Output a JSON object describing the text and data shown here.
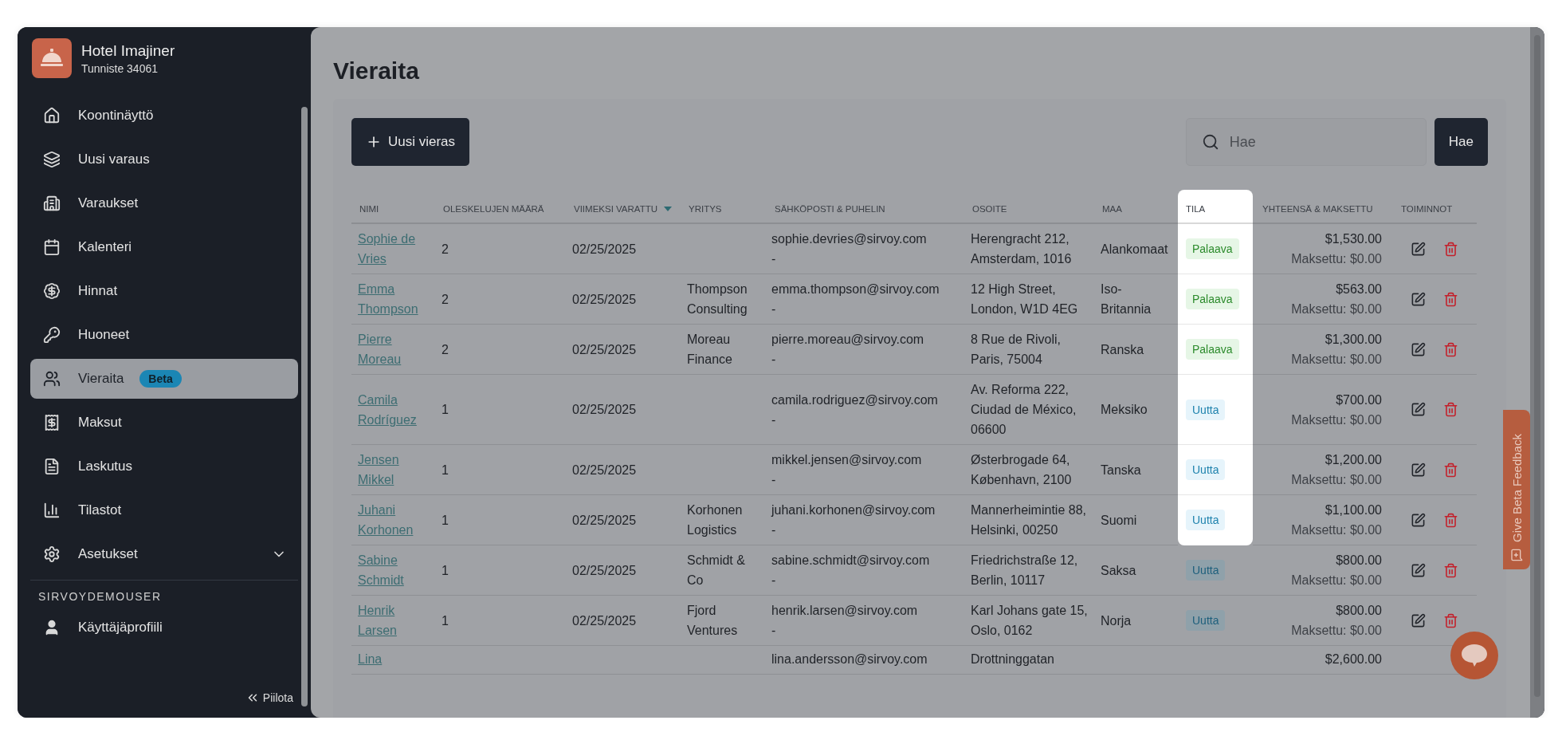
{
  "sidebar": {
    "hotel_name": "Hotel Imajiner",
    "hotel_id": "Tunniste 34061",
    "items": [
      {
        "label": "Koontinäyttö",
        "selected": false
      },
      {
        "label": "Uusi varaus",
        "selected": false
      },
      {
        "label": "Varaukset",
        "selected": false
      },
      {
        "label": "Kalenteri",
        "selected": false
      },
      {
        "label": "Hinnat",
        "selected": false
      },
      {
        "label": "Huoneet",
        "selected": false
      },
      {
        "label": "Vieraita",
        "selected": true,
        "badge": "Beta"
      },
      {
        "label": "Maksut",
        "selected": false
      },
      {
        "label": "Laskutus",
        "selected": false
      },
      {
        "label": "Tilastot",
        "selected": false
      },
      {
        "label": "Asetukset",
        "selected": false,
        "expanded": false
      }
    ],
    "user_section": "SIRVOYDEMOUSER",
    "user_items": [
      {
        "label": "Käyttäjäprofiili",
        "selected": false
      }
    ],
    "collapse": "Piilota"
  },
  "page_title": "Vieraita",
  "new_button": "Uusi vieras",
  "search": {
    "placeholder": "Hae",
    "button": "Hae"
  },
  "table": {
    "columns": [
      {
        "label": "NIMI",
        "sorted": false,
        "highlighted": false
      },
      {
        "label": "OLESKELUJEN MÄÄRÄ",
        "sorted": false,
        "highlighted": false
      },
      {
        "label": "VIIMEKSI VARATTU",
        "sorted": true,
        "highlighted": false
      },
      {
        "label": "YRITYS",
        "sorted": false,
        "highlighted": false
      },
      {
        "label": "SÄHKÖPOSTI & PUHELIN",
        "sorted": false,
        "highlighted": false
      },
      {
        "label": "OSOITE",
        "sorted": false,
        "highlighted": false
      },
      {
        "label": "MAA",
        "sorted": false,
        "highlighted": false
      },
      {
        "label": "TILA",
        "sorted": false,
        "highlighted": true
      },
      {
        "label": "YHTEENSÄ & MAKSETTU",
        "sorted": false,
        "highlighted": false
      },
      {
        "label": "TOIMINNOT",
        "sorted": false,
        "highlighted": false
      }
    ],
    "rows": [
      {
        "name": "Sophie de Vries",
        "stays": "2",
        "last_booked": "02/25/2025",
        "email": "sophie.devries@sirvoy.com",
        "phone": "-",
        "address": "Herengracht 212, Amsterdam, 1016",
        "country": "Alankomaat",
        "status": {
          "label": "Palaava",
          "kind": "returning",
          "highlighted": true
        },
        "total": "$1,530.00",
        "paid": "Maksettu: $0.00",
        "partial": false
      },
      {
        "name": "Emma Thompson",
        "stays": "2",
        "last_booked": "02/25/2025",
        "company": "Thompson Consulting",
        "email": "emma.thompson@sirvoy.com",
        "phone": "-",
        "address": "12 High Street, London, W1D 4EG",
        "country": "Iso-Britannia",
        "status": {
          "label": "Palaava",
          "kind": "returning",
          "highlighted": true
        },
        "total": "$563.00",
        "paid": "Maksettu: $0.00",
        "partial": false
      },
      {
        "name": "Pierre Moreau",
        "stays": "2",
        "last_booked": "02/25/2025",
        "company": "Moreau Finance",
        "email": "pierre.moreau@sirvoy.com",
        "phone": "-",
        "address": "8 Rue de Rivoli, Paris, 75004",
        "country": "Ranska",
        "status": {
          "label": "Palaava",
          "kind": "returning",
          "highlighted": true
        },
        "total": "$1,300.00",
        "paid": "Maksettu: $0.00",
        "partial": false
      },
      {
        "name": "Camila Rodríguez",
        "stays": "1",
        "last_booked": "02/25/2025",
        "email": "camila.rodriguez@sirvoy.com",
        "phone": "-",
        "address": "Av. Reforma 222, Ciudad de México, 06600",
        "country": "Meksiko",
        "status": {
          "label": "Uutta",
          "kind": "new",
          "highlighted": true
        },
        "total": "$700.00",
        "paid": "Maksettu: $0.00",
        "partial": false
      },
      {
        "name": "Jensen Mikkel",
        "stays": "1",
        "last_booked": "02/25/2025",
        "email": "mikkel.jensen@sirvoy.com",
        "phone": "-",
        "address": "Østerbrogade 64, København, 2100",
        "country": "Tanska",
        "status": {
          "label": "Uutta",
          "kind": "new",
          "highlighted": true
        },
        "total": "$1,200.00",
        "paid": "Maksettu: $0.00",
        "partial": false
      },
      {
        "name": "Juhani Korhonen",
        "stays": "1",
        "last_booked": "02/25/2025",
        "company": "Korhonen Logistics",
        "email": "juhani.korhonen@sirvoy.com",
        "phone": "-",
        "address": "Mannerheimintie 88, Helsinki, 00250",
        "country": "Suomi",
        "status": {
          "label": "Uutta",
          "kind": "new",
          "highlighted": true
        },
        "total": "$1,100.00",
        "paid": "Maksettu: $0.00",
        "partial": false
      },
      {
        "name": "Sabine Schmidt",
        "stays": "1",
        "last_booked": "02/25/2025",
        "company": "Schmidt & Co",
        "email": "sabine.schmidt@sirvoy.com",
        "phone": "-",
        "address": "Friedrichstraße 12, Berlin, 10117",
        "country": "Saksa",
        "status": {
          "label": "Uutta",
          "kind": "new",
          "highlighted": false
        },
        "total": "$800.00",
        "paid": "Maksettu: $0.00",
        "partial": false
      },
      {
        "name": "Henrik Larsen",
        "stays": "1",
        "last_booked": "02/25/2025",
        "company": "Fjord Ventures",
        "email": "henrik.larsen@sirvoy.com",
        "phone": "-",
        "address": "Karl Johans gate 15, Oslo, 0162",
        "country": "Norja",
        "status": {
          "label": "Uutta",
          "kind": "new",
          "highlighted": false
        },
        "total": "$800.00",
        "paid": "Maksettu: $0.00",
        "partial": false
      },
      {
        "name": "Lina",
        "email": "lina.andersson@sirvoy.com",
        "address": "Drottninggatan",
        "total": "$2,600.00",
        "partial": true
      }
    ]
  },
  "feedback_tab": "Give Beta Feedback"
}
